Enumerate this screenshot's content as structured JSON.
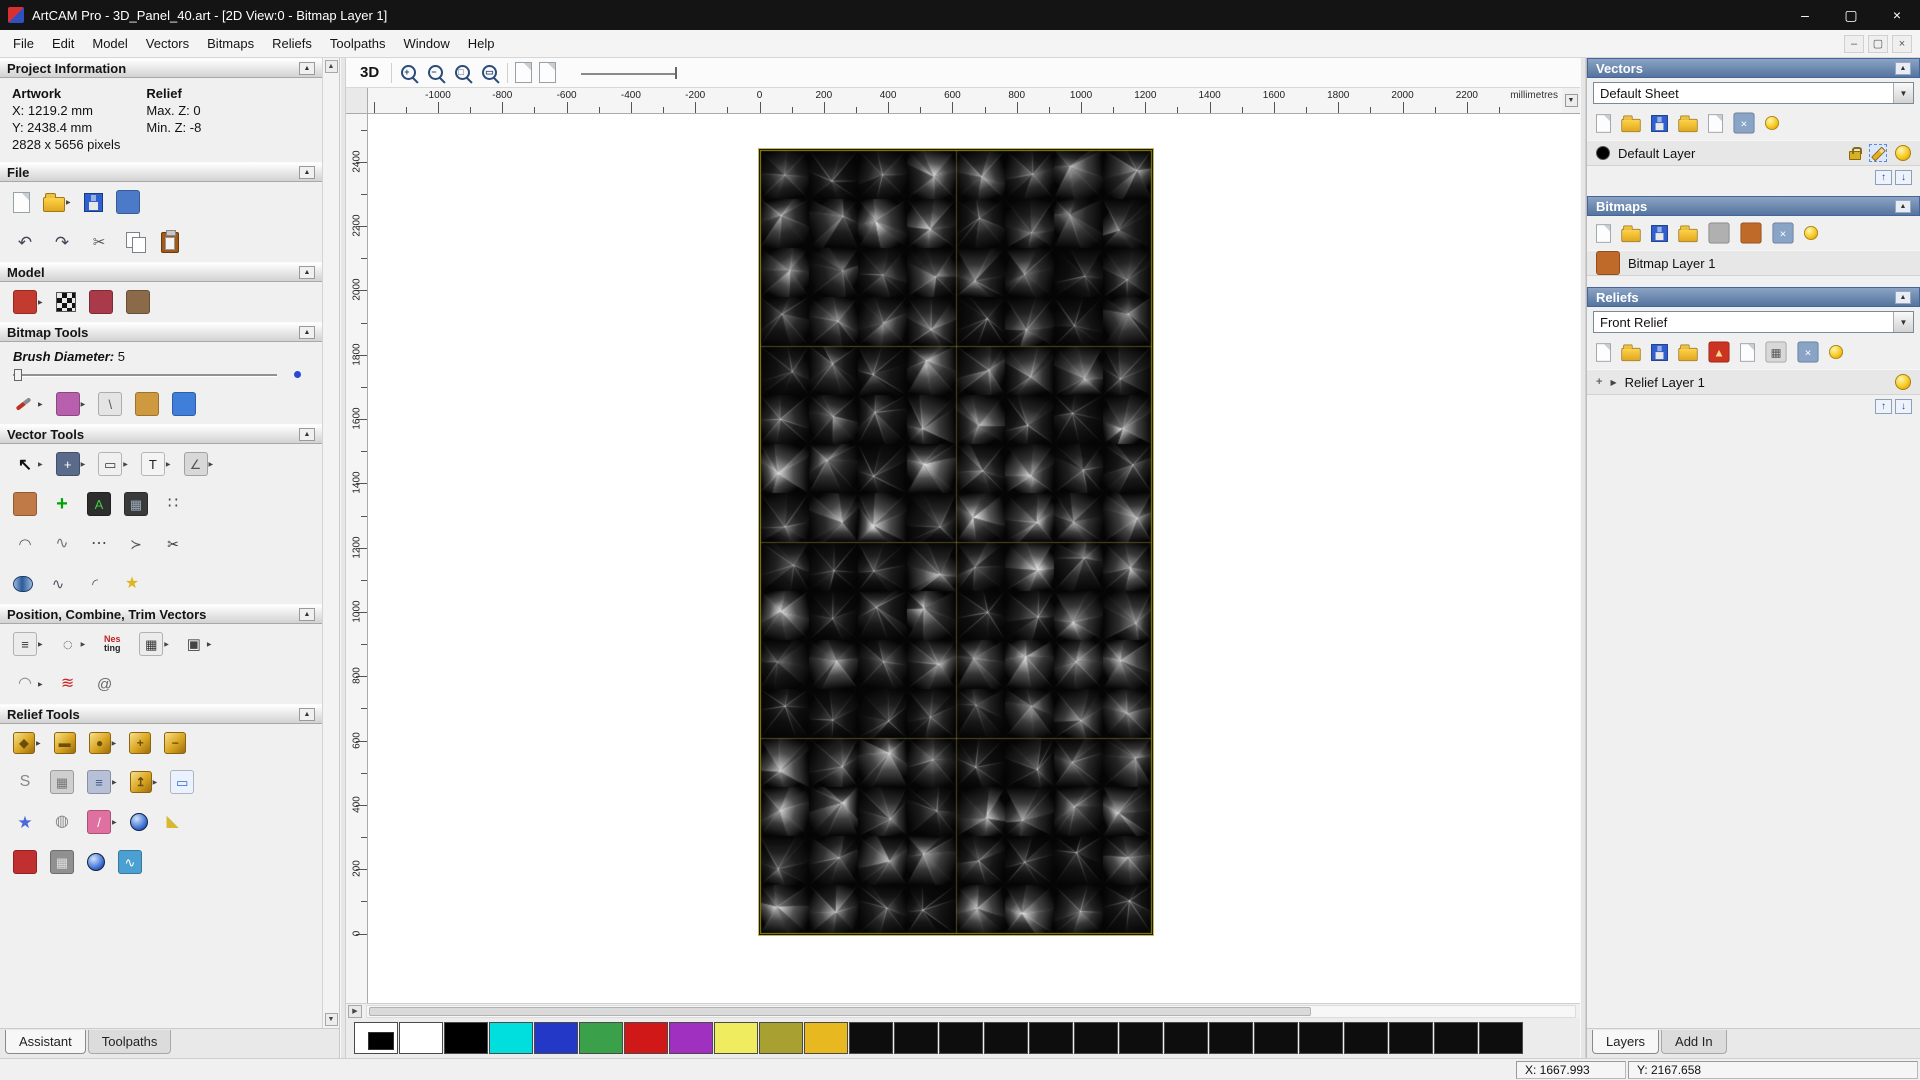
{
  "window": {
    "title": "ArtCAM Pro - 3D_Panel_40.art - [2D View:0 - Bitmap Layer 1]",
    "minimize": "–",
    "maximize": "▢",
    "close": "×"
  },
  "menu": {
    "items": [
      "File",
      "Edit",
      "Model",
      "Vectors",
      "Bitmaps",
      "Reliefs",
      "Toolpaths",
      "Window",
      "Help"
    ],
    "mdi_minimize": "–",
    "mdi_restore": "▢",
    "mdi_close": "×"
  },
  "view_toolbar": {
    "view3d_label": "3D",
    "zoom_icons": [
      {
        "name": "zoom-in-icon",
        "sign": "+"
      },
      {
        "name": "zoom-out-icon",
        "sign": "−"
      },
      {
        "name": "zoom-box-icon",
        "sign": "□"
      },
      {
        "name": "zoom-fit-icon",
        "sign": "▭"
      }
    ],
    "extra_icons": [
      {
        "name": "toggle-bitmap-view-icon",
        "kind": "page"
      },
      {
        "name": "toggle-relief-view-icon",
        "kind": "page"
      }
    ]
  },
  "ruler": {
    "unit_label": "millimetres",
    "h_labels": [
      -1000,
      -800,
      -600,
      -400,
      -200,
      0,
      200,
      400,
      600,
      800,
      1000,
      1200,
      1400,
      1600,
      1800,
      2000,
      2200
    ],
    "v_labels": [
      2400,
      2200,
      2000,
      1800,
      1600,
      1400,
      1200,
      1000,
      800,
      600,
      400,
      200,
      0
    ]
  },
  "artwork": {
    "type": "relief-bitmap-preview",
    "pattern": "faceted-pyramid-triangles-greyscale",
    "width_mm": 1219.2,
    "height_mm": 2438.4,
    "cols": 8,
    "rows": 16,
    "seed": 11,
    "seam_color": "#b0a040",
    "border_color": "#8a7d20",
    "background": "#000000"
  },
  "left_panel": {
    "tabs": [
      {
        "label": "Assistant",
        "active": true
      },
      {
        "label": "Toolpaths",
        "active": false
      }
    ],
    "project_info": {
      "artwork_title": "Artwork",
      "relief_title": "Relief",
      "x": "X: 1219.2 mm",
      "y": "Y: 2438.4 mm",
      "max_z": "Max. Z: 0",
      "min_z": "Min. Z: -8",
      "pixels": "2828 x 5656 pixels"
    },
    "brush": {
      "label": "Brush Diameter:",
      "value": "5"
    },
    "sections": [
      {
        "title": "Project Information",
        "type": "info"
      },
      {
        "title": "File",
        "type": "icons",
        "rows": [
          [
            {
              "name": "new-model-icon",
              "kind": "page"
            },
            {
              "name": "open-model-icon",
              "kind": "folder",
              "arrow": true
            },
            {
              "name": "save-model-icon",
              "kind": "disk"
            },
            {
              "name": "edit-model-icon",
              "kind": "blob",
              "color": "#4a7ac8"
            }
          ],
          [
            {
              "name": "undo-icon",
              "kind": "glyph",
              "glyph": "↶",
              "color": "#445",
              "size": 17
            },
            {
              "name": "redo-icon",
              "kind": "glyph",
              "glyph": "↷",
              "color": "#445",
              "size": 17
            },
            {
              "name": "cut-icon",
              "kind": "glyph",
              "glyph": "✂",
              "color": "#555",
              "size": 15
            },
            {
              "name": "copy-icon",
              "kind": "copy"
            },
            {
              "name": "paste-icon",
              "kind": "paste"
            }
          ]
        ]
      },
      {
        "title": "Model",
        "type": "icons",
        "rows": [
          [
            {
              "name": "set-model-size-icon",
              "kind": "blob",
              "color": "#c23b2e",
              "arrow": true
            },
            {
              "name": "invert-greyscale-icon",
              "kind": "checker"
            },
            {
              "name": "model-volume-icon",
              "kind": "blob",
              "color": "#a83a4a"
            },
            {
              "name": "load-picture-icon",
              "kind": "blob",
              "color": "#8a6a48"
            }
          ]
        ]
      },
      {
        "title": "Bitmap Tools",
        "type": "brush",
        "rows": [
          [
            {
              "name": "paint-brush-icon",
              "kind": "brush",
              "arrow": true
            },
            {
              "name": "paint-selective-icon",
              "kind": "blob",
              "color": "#b85fae",
              "arrow": true
            },
            {
              "name": "colour-picker-icon",
              "kind": "blob",
              "color": "#e4e4e4",
              "glyph": "\\",
              "fg": "#555"
            },
            {
              "name": "palette-icon",
              "kind": "blob",
              "color": "#cf9a3f"
            },
            {
              "name": "flood-fill-icon",
              "kind": "blob",
              "color": "#3f7fd9"
            }
          ]
        ]
      },
      {
        "title": "Vector Tools",
        "type": "icons",
        "rows": [
          [
            {
              "name": "select-vectors-icon",
              "kind": "glyph",
              "glyph": "↖",
              "color": "#111",
              "size": 17,
              "bold": true,
              "arrow": true
            },
            {
              "name": "transform-vectors-icon",
              "kind": "blob",
              "color": "#5a6a8a",
              "glyph": "+",
              "fg": "#fff",
              "arrow": true
            },
            {
              "name": "create-rectangle-icon",
              "kind": "blob",
              "color": "#f0f0f0",
              "glyph": "▭",
              "fg": "#333",
              "arrow": true
            },
            {
              "name": "create-text-icon",
              "kind": "blob",
              "color": "#f4f4f4",
              "glyph": "T",
              "fg": "#222",
              "arrow": true
            },
            {
              "name": "measure-icon",
              "kind": "blob",
              "color": "#d8d8d8",
              "glyph": "∠",
              "fg": "#555",
              "arrow": true
            }
          ],
          [
            {
              "name": "fit-vectors-icon",
              "kind": "blob",
              "color": "#c07a48"
            },
            {
              "name": "create-cross-icon",
              "kind": "glyph",
              "glyph": "+",
              "color": "#00a400",
              "size": 20,
              "bold": true
            },
            {
              "name": "paste-text-icon",
              "kind": "blob",
              "color": "#2d2d2d",
              "glyph": "A",
              "fg": "#44cc44"
            },
            {
              "name": "vector-grid-icon",
              "kind": "blob",
              "color": "#3a3a3a",
              "glyph": "▦",
              "fg": "#99aabb"
            },
            {
              "name": "point-cloud-icon",
              "kind": "glyph",
              "glyph": "∷",
              "color": "#444",
              "size": 16
            }
          ],
          [
            {
              "name": "create-bezier-icon",
              "kind": "glyph",
              "glyph": "◠",
              "color": "#555",
              "size": 15
            },
            {
              "name": "free-smooth-icon",
              "kind": "glyph",
              "glyph": "∿",
              "color": "#777",
              "size": 16
            },
            {
              "name": "node-edit-icon",
              "kind": "glyph",
              "glyph": "⋯",
              "color": "#444",
              "size": 16
            },
            {
              "name": "create-polyline-icon",
              "kind": "glyph",
              "glyph": "≻",
              "color": "#555",
              "size": 14
            },
            {
              "name": "trim-vectors-icon",
              "kind": "glyph",
              "glyph": "✂",
              "color": "#333",
              "size": 14
            }
          ],
          [
            {
              "name": "create-cylinder-icon",
              "kind": "cyl"
            },
            {
              "name": "fit-curve-icon",
              "kind": "glyph",
              "glyph": "∿",
              "color": "#556",
              "size": 15
            },
            {
              "name": "fit-arc-icon",
              "kind": "glyph",
              "glyph": "◜",
              "color": "#556",
              "size": 15
            },
            {
              "name": "vector-wizard-icon",
              "kind": "glyph",
              "glyph": "★",
              "color": "#e0b420",
              "size": 16
            }
          ]
        ]
      },
      {
        "title": "Position, Combine, Trim Vectors",
        "type": "icons",
        "rows": [
          [
            {
              "name": "align-vectors-icon",
              "kind": "blob",
              "color": "#ececec",
              "glyph": "≡",
              "fg": "#333",
              "arrow": true
            },
            {
              "name": "circular-copy-icon",
              "kind": "glyph",
              "glyph": "◌",
              "color": "#555",
              "size": 17,
              "arrow": true
            },
            {
              "name": "nesting-icon",
              "kind": "nes",
              "top": "Nes",
              "bottom": "ting"
            },
            {
              "name": "block-copy-icon",
              "kind": "blob",
              "color": "#ececec",
              "glyph": "▦",
              "fg": "#333",
              "arrow": true
            },
            {
              "name": "copy-rotate-icon",
              "kind": "glyph",
              "glyph": "▣",
              "color": "#444",
              "size": 15,
              "arrow": true
            }
          ],
          [
            {
              "name": "mirror-vectors-icon",
              "kind": "glyph",
              "glyph": "◠",
              "color": "#888",
              "size": 16,
              "arrow": true
            },
            {
              "name": "weld-vectors-icon",
              "kind": "glyph",
              "glyph": "≋",
              "color": "#cc2222",
              "size": 16
            },
            {
              "name": "create-spiral-icon",
              "kind": "glyph",
              "glyph": "@",
              "color": "#666",
              "size": 15
            }
          ]
        ]
      },
      {
        "title": "Relief Tools",
        "type": "icons",
        "rows": [
          [
            {
              "name": "shape-editor-icon",
              "kind": "gold",
              "glyph": "◆",
              "arrow": true
            },
            {
              "name": "smooth-relief-icon",
              "kind": "gold",
              "glyph": "▬"
            },
            {
              "name": "sculpt-relief-icon",
              "kind": "gold",
              "glyph": "●",
              "arrow": true
            },
            {
              "name": "add-relief-icon",
              "kind": "gold",
              "glyph": "+"
            },
            {
              "name": "subtract-relief-icon",
              "kind": "gold",
              "glyph": "−"
            }
          ],
          [
            {
              "name": "smooth-filter-icon",
              "kind": "glyph",
              "glyph": "S",
              "color": "#888",
              "size": 16
            },
            {
              "name": "texture-relief-icon",
              "kind": "blob",
              "color": "#cfcfcf",
              "glyph": "▦",
              "fg": "#777"
            },
            {
              "name": "relief-library-icon",
              "kind": "blob",
              "color": "#b8c0d8",
              "glyph": "≡",
              "fg": "#445588",
              "arrow": true
            },
            {
              "name": "raise-relief-icon",
              "kind": "gold",
              "glyph": "↥",
              "arrow": true
            },
            {
              "name": "relief-envelope-icon",
              "kind": "blob",
              "color": "#eaf2ff",
              "glyph": "▭",
              "fg": "#3366cc"
            }
          ],
          [
            {
              "name": "star-relief-icon",
              "kind": "glyph",
              "glyph": "★",
              "color": "#4a6ad8",
              "size": 17
            },
            {
              "name": "wrap-relief-icon",
              "kind": "glyph",
              "glyph": "◍",
              "color": "#888",
              "size": 16
            },
            {
              "name": "paint-relief-icon",
              "kind": "blob",
              "color": "#e070a0",
              "glyph": "/",
              "fg": "#fff",
              "arrow": true
            },
            {
              "name": "dome-relief-icon",
              "kind": "sphere"
            },
            {
              "name": "angle-relief-icon",
              "kind": "glyph",
              "glyph": "◣",
              "color": "#d8b830",
              "size": 16
            }
          ],
          [
            {
              "name": "offset-relief-icon",
              "kind": "blob",
              "color": "#c03030"
            },
            {
              "name": "mesh-relief-icon",
              "kind": "blob",
              "color": "#909090",
              "glyph": "▦",
              "fg": "#ddd"
            },
            {
              "name": "sphere-relief-icon",
              "kind": "sphere"
            },
            {
              "name": "wave-relief-icon",
              "kind": "blob",
              "color": "#4aa0d0",
              "glyph": "∿",
              "fg": "#fff"
            }
          ]
        ]
      }
    ]
  },
  "right_panel": {
    "vectors": {
      "title": "Vectors",
      "sheet": "Default Sheet",
      "layer_label": "Default Layer",
      "toolbar": [
        {
          "name": "new-vector-sheet-icon",
          "kind": "page"
        },
        {
          "name": "open-vectors-icon",
          "kind": "folder"
        },
        {
          "name": "save-vectors-icon",
          "kind": "disk"
        },
        {
          "name": "import-vectors-icon",
          "kind": "folder"
        },
        {
          "name": "export-vectors-icon",
          "kind": "page"
        },
        {
          "name": "delete-vector-sheet-icon",
          "kind": "blob",
          "color": "#8aa4c8",
          "glyph": "×",
          "fg": "#fff"
        },
        {
          "name": "show-all-vector-layers-icon",
          "kind": "bulb"
        }
      ]
    },
    "bitmaps": {
      "title": "Bitmaps",
      "layer_label": "Bitmap Layer 1",
      "toolbar": [
        {
          "name": "new-bitmap-layer-icon",
          "kind": "page"
        },
        {
          "name": "open-bitmap-icon",
          "kind": "folder"
        },
        {
          "name": "save-bitmap-icon",
          "kind": "disk"
        },
        {
          "name": "import-bitmap-icon",
          "kind": "folder"
        },
        {
          "name": "merge-bitmap-layers-icon",
          "kind": "blob",
          "color": "#b0b0b0"
        },
        {
          "name": "painter-icon",
          "kind": "blob",
          "color": "#c06a2a"
        },
        {
          "name": "delete-bitmap-layer-icon",
          "kind": "blob",
          "color": "#8aa4c8",
          "glyph": "×",
          "fg": "#fff"
        },
        {
          "name": "show-bitmap-layers-icon",
          "kind": "bulb"
        }
      ]
    },
    "reliefs": {
      "title": "Reliefs",
      "relief": "Front Relief",
      "layer_label": "Relief Layer 1",
      "toolbar": [
        {
          "name": "new-relief-layer-icon",
          "kind": "page"
        },
        {
          "name": "open-relief-icon",
          "kind": "folder"
        },
        {
          "name": "save-relief-icon",
          "kind": "disk"
        },
        {
          "name": "import-relief-icon",
          "kind": "folder"
        },
        {
          "name": "calculate-relief-icon",
          "kind": "blob",
          "color": "#cc3322",
          "glyph": "▲",
          "fg": "#ffdd88"
        },
        {
          "name": "duplicate-relief-icon",
          "kind": "page"
        },
        {
          "name": "relief-calculator-icon",
          "kind": "blob",
          "color": "#d8d8d8",
          "glyph": "▦",
          "fg": "#555"
        },
        {
          "name": "delete-relief-layer-icon",
          "kind": "blob",
          "color": "#8aa4c8",
          "glyph": "×",
          "fg": "#fff"
        },
        {
          "name": "show-relief-layers-icon",
          "kind": "bulb"
        }
      ]
    },
    "tabs": [
      {
        "label": "Layers",
        "active": true
      },
      {
        "label": "Add In",
        "active": false
      }
    ]
  },
  "palette": {
    "primary_secondary": {
      "fg": "#ffffff",
      "bg": "#000000"
    },
    "swatches": [
      "#ffffff",
      "#000000",
      "#00dede",
      "#2438c8",
      "#3aa04a",
      "#d01818",
      "#a030c0",
      "#f0ec60",
      "#a8a030",
      "#e8b820",
      "#0d0d0d",
      "#0d0d0d",
      "#0d0d0d",
      "#0d0d0d",
      "#0d0d0d",
      "#0d0d0d",
      "#0d0d0d",
      "#0d0d0d",
      "#0d0d0d",
      "#0d0d0d",
      "#0d0d0d",
      "#0d0d0d",
      "#0d0d0d",
      "#0d0d0d",
      "#0d0d0d"
    ]
  },
  "status": {
    "x_label": "X: 1667.993",
    "y_label": "Y: 2167.658"
  }
}
